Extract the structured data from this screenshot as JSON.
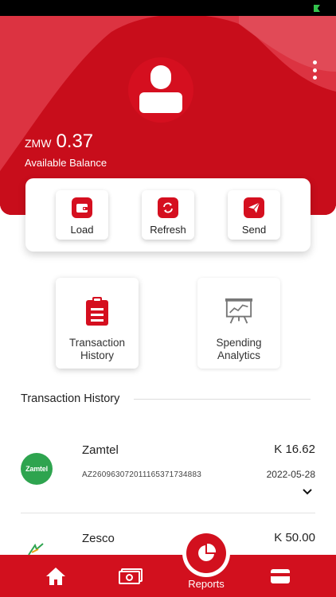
{
  "wallet": {
    "currency": "ZMW",
    "balance": "0.37",
    "balance_label": "Available Balance"
  },
  "actions": [
    {
      "label": "Load",
      "icon": "wallet-icon"
    },
    {
      "label": "Refresh",
      "icon": "refresh-icon"
    },
    {
      "label": "Send",
      "icon": "send-icon"
    }
  ],
  "tiles": {
    "transaction_history": {
      "line1": "Transaction",
      "line2": "History",
      "icon": "clipboard-icon"
    },
    "spending_analytics": {
      "line1": "Spending",
      "line2": "Analytics",
      "icon": "presentation-chart-icon"
    }
  },
  "section_title": "Transaction History",
  "transactions": [
    {
      "name": "Zamtel",
      "logo_text": "Zamtel",
      "reference": "AZ260963072011165371734883",
      "amount": "K 16.62",
      "date": "2022-05-28"
    },
    {
      "name": "Zesco",
      "amount": "K 50.00"
    }
  ],
  "nav": {
    "reports_label": "Reports",
    "items": [
      "home-icon",
      "money-icon",
      "reports-icon",
      "card-icon"
    ]
  },
  "colors": {
    "brand_red": "#d2101e",
    "zamtel_green": "#2ea44f",
    "white": "#ffffff"
  }
}
